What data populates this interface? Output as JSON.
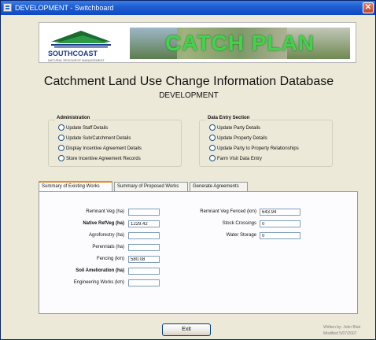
{
  "window": {
    "title": "DEVELOPMENT - Switchboard"
  },
  "banner": {
    "logo_text": "SOUTHCOAST",
    "logo_sub": "NATURAL RESOURCE MANAGEMENT",
    "catch_plan": "CATCH PLAN"
  },
  "heading": {
    "title": "Catchment Land Use Change Information Database",
    "subtitle": "DEVELOPMENT"
  },
  "administration": {
    "label": "Administration",
    "options": [
      "Update Staff Details",
      "Update Sub/Catchment Details",
      "Display Incentive Agreement Details",
      "Store Incentive Agreement Records"
    ]
  },
  "data_entry": {
    "label": "Data Entry Section",
    "options": [
      "Update Party Details",
      "Update Property Details",
      "Update Party to Property Relationships",
      "Farm Visit Data Entry"
    ]
  },
  "tabs": [
    "Summary of Existing Works",
    "Summary of Proposed Works",
    "Generate Agreements"
  ],
  "left_fields": [
    {
      "label": "Remnant Veg (ha)",
      "value": "",
      "bold": false
    },
    {
      "label": "Native RefVeg (ha)",
      "value": "1229.42",
      "bold": true
    },
    {
      "label": "Agroforestry (ha)",
      "value": "",
      "bold": false
    },
    {
      "label": "Perennials (ha)",
      "value": "",
      "bold": false
    },
    {
      "label": "Fencing (km)",
      "value": "580.08",
      "bold": false
    },
    {
      "label": "Soil Amelioration (ha)",
      "value": "",
      "bold": true
    },
    {
      "label": "Engineering Works (km)",
      "value": "",
      "bold": false
    }
  ],
  "right_fields": [
    {
      "label": "Remnant Veg Fenced (km)",
      "value": "643.94"
    },
    {
      "label": "Stock Crossings",
      "value": "0"
    },
    {
      "label": "Water Storage",
      "value": "0"
    }
  ],
  "exit_label": "Exit",
  "footer": {
    "line1": "Written by: John Blair",
    "line2": "Modified 5/07/2007"
  },
  "colors": {
    "titlebar": "#0f49c2",
    "catch_plan_text": "#3fd54a",
    "tab_highlight": "#e68b2c"
  }
}
